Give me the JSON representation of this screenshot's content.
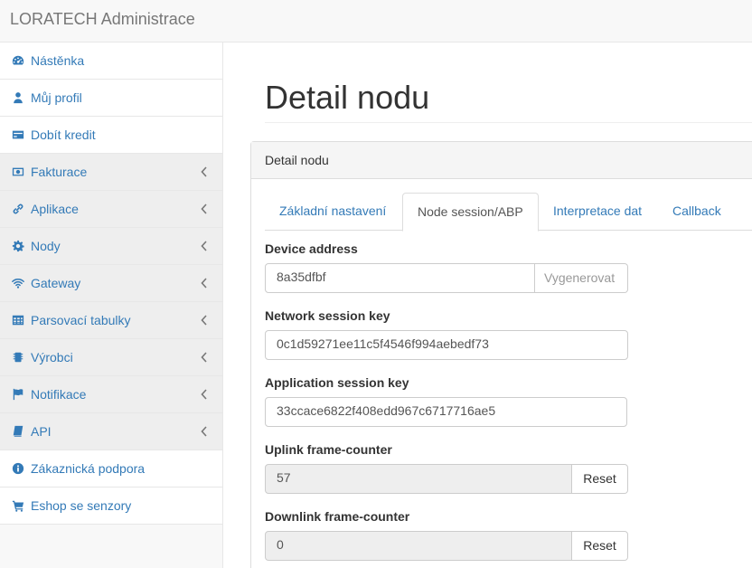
{
  "header": {
    "brand": "LORATECH Administrace"
  },
  "sidebar": {
    "items": [
      {
        "label": "Nástěnka",
        "icon": "dashboard-icon",
        "has_submenu": false
      },
      {
        "label": "Můj profil",
        "icon": "user-icon",
        "has_submenu": false
      },
      {
        "label": "Dobít kredit",
        "icon": "credit-card-icon",
        "has_submenu": false
      },
      {
        "label": "Fakturace",
        "icon": "money-icon",
        "has_submenu": true
      },
      {
        "label": "Aplikace",
        "icon": "link-icon",
        "has_submenu": true
      },
      {
        "label": "Nody",
        "icon": "gear-icon",
        "has_submenu": true
      },
      {
        "label": "Gateway",
        "icon": "wifi-icon",
        "has_submenu": true
      },
      {
        "label": "Parsovací tabulky",
        "icon": "table-icon",
        "has_submenu": true
      },
      {
        "label": "Výrobci",
        "icon": "chip-icon",
        "has_submenu": true
      },
      {
        "label": "Notifikace",
        "icon": "flag-icon",
        "has_submenu": true
      },
      {
        "label": "API",
        "icon": "book-icon",
        "has_submenu": true
      },
      {
        "label": "Zákaznická podpora",
        "icon": "info-icon",
        "has_submenu": false
      },
      {
        "label": "Eshop se senzory",
        "icon": "cart-icon",
        "has_submenu": false
      }
    ]
  },
  "main": {
    "page_title": "Detail nodu",
    "panel_heading": "Detail nodu",
    "tabs": [
      {
        "label": "Základní nastavení",
        "active": false
      },
      {
        "label": "Node session/ABP",
        "active": true
      },
      {
        "label": "Interpretace dat",
        "active": false
      },
      {
        "label": "Callback",
        "active": false
      }
    ],
    "form": {
      "device_address": {
        "label": "Device address",
        "value": "8a35dfbf",
        "button": "Vygenerovat"
      },
      "network_session_key": {
        "label": "Network session key",
        "value": "0c1d59271ee11c5f4546f994aebedf73"
      },
      "application_session_key": {
        "label": "Application session key",
        "value": "33ccace6822f408edd967c6717716ae5"
      },
      "uplink_counter": {
        "label": "Uplink frame-counter",
        "value": "57",
        "button": "Reset"
      },
      "downlink_counter": {
        "label": "Downlink frame-counter",
        "value": "0",
        "button": "Reset"
      }
    }
  },
  "colors": {
    "link": "#337ab7",
    "sidebar_bg": "#f8f8f8",
    "submenu_bg": "#eeeeee"
  }
}
